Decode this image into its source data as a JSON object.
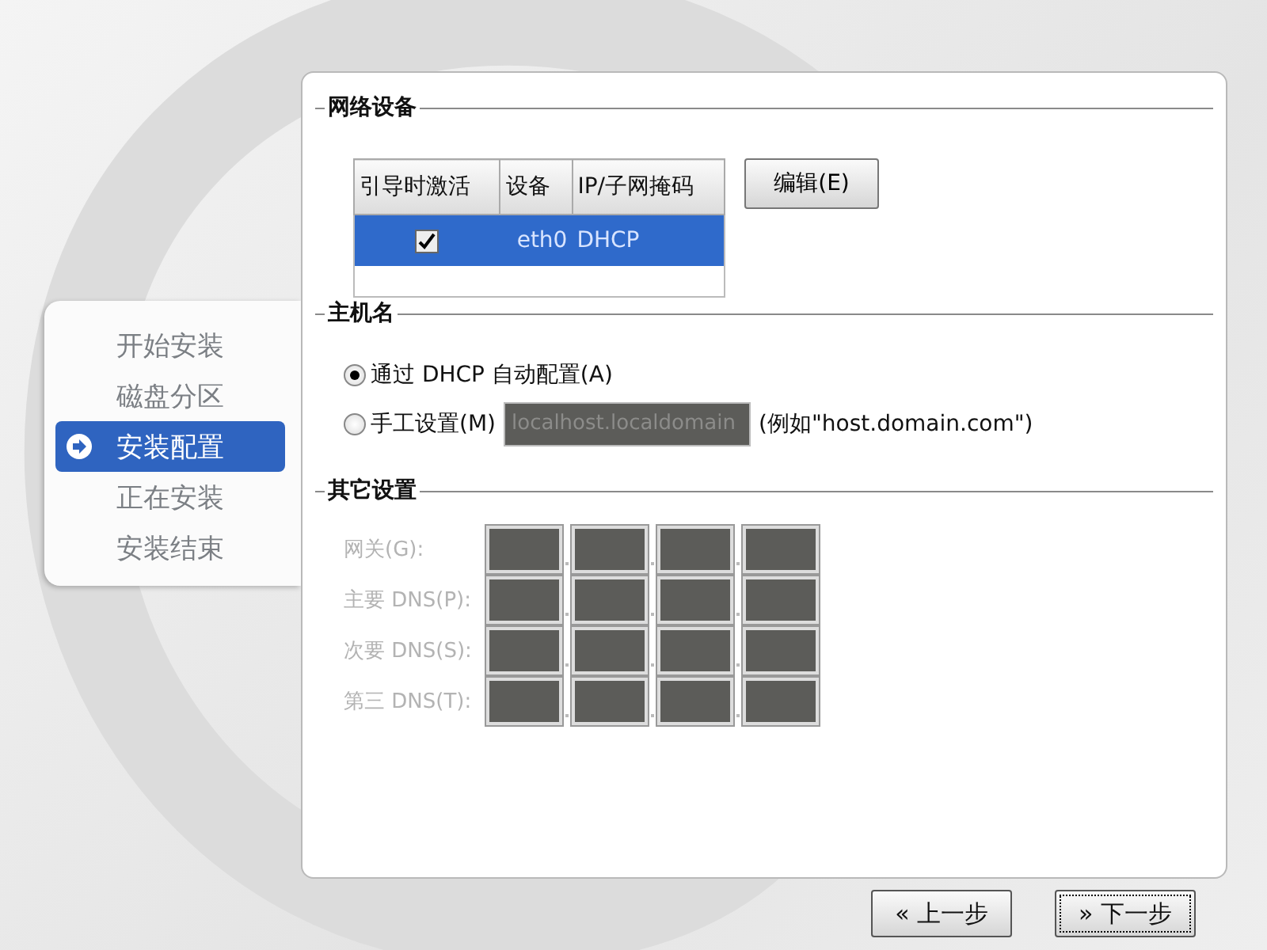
{
  "steps": [
    {
      "label": "开始安装",
      "selected": false
    },
    {
      "label": "磁盘分区",
      "selected": false
    },
    {
      "label": "安装配置",
      "selected": true
    },
    {
      "label": "正在安装",
      "selected": false
    },
    {
      "label": "安装结束",
      "selected": false
    }
  ],
  "network_devices": {
    "title": "网络设备",
    "columns": [
      "引导时激活",
      "设备",
      "IP/子网掩码"
    ],
    "rows": [
      {
        "active_on_boot": true,
        "device": "eth0",
        "address": "DHCP",
        "selected": true
      }
    ],
    "edit_button": "编辑(E)"
  },
  "hostname": {
    "title": "主机名",
    "options": [
      {
        "label": "通过 DHCP 自动配置(A)",
        "selected": true
      },
      {
        "label": "手工设置(M)",
        "selected": false
      }
    ],
    "field": {
      "value": "localhost.localdomain",
      "disabled": true
    },
    "hint": "(例如\"host.domain.com\")"
  },
  "other_settings": {
    "title": "其它设置",
    "rows": [
      {
        "label": "网关(G):",
        "disabled": true
      },
      {
        "label": "主要 DNS(P):",
        "disabled": true
      },
      {
        "label": "次要 DNS(S):",
        "disabled": true
      },
      {
        "label": "第三 DNS(T):",
        "disabled": true
      }
    ]
  },
  "buttons": [
    {
      "label": "« 上一步",
      "focused": false
    },
    {
      "label": "» 下一步",
      "focused": true
    }
  ]
}
